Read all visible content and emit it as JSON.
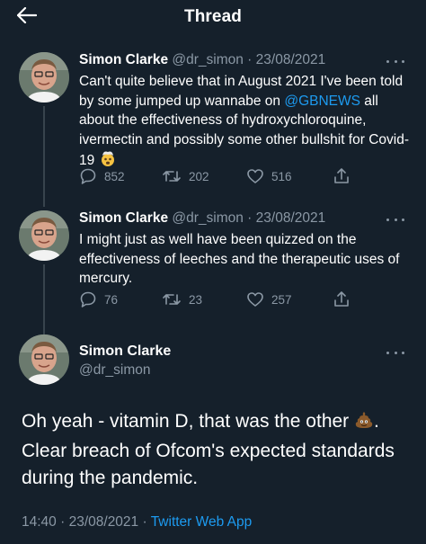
{
  "header": {
    "title": "Thread",
    "back_icon": "arrow-left-icon"
  },
  "tweets": [
    {
      "name": "Simon Clarke",
      "handle": "@dr_simon",
      "dot": "·",
      "date": "23/08/2021",
      "text_before": "Can't quite believe that in August 2021 I've been told by some jumped up wannabe on ",
      "mention": "@GBNEWS",
      "text_after": " all about the effectiveness of hydroxychloroquine, ivermectin and possibly some other bullshit for Covid-19 ",
      "emoji": "exploding-head-emoji",
      "replies": "852",
      "retweets": "202",
      "likes": "516"
    },
    {
      "name": "Simon Clarke",
      "handle": "@dr_simon",
      "dot": "·",
      "date": "23/08/2021",
      "text": "I might just as well have been quizzed on the effectiveness of leeches and the therapeutic uses of mercury.",
      "replies": "76",
      "retweets": "23",
      "likes": "257"
    }
  ],
  "main_tweet": {
    "name": "Simon Clarke",
    "handle": "@dr_simon",
    "text_before": "Oh yeah - vitamin D, that was the other ",
    "emoji": "pile-of-poo-emoji",
    "text_after": ". Clear breach of Ofcom's expected standards during the pandemic.",
    "time": "14:40",
    "dot": "·",
    "date": "23/08/2021",
    "dot2": "·",
    "app": "Twitter Web App"
  },
  "colors": {
    "background": "#15202b",
    "secondary_text": "#8b98a5",
    "link": "#1d9bf0"
  }
}
